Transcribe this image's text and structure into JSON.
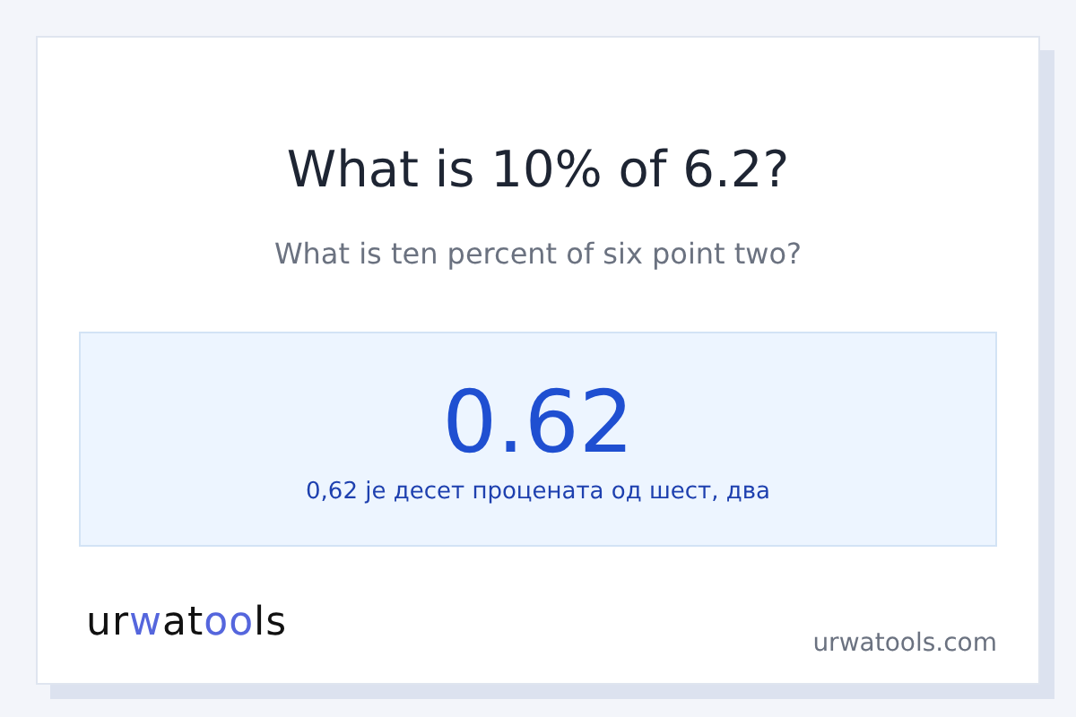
{
  "title": "What is 10% of 6.2?",
  "subtitle": "What is ten percent of six point two?",
  "result": {
    "value": "0.62",
    "sentence": "0,62 је десет процената од шест, два"
  },
  "logo": [
    {
      "text": "ur",
      "accent": false
    },
    {
      "text": "w",
      "accent": true
    },
    {
      "text": "at",
      "accent": false
    },
    {
      "text": "oo",
      "accent": true
    },
    {
      "text": "ls",
      "accent": false
    }
  ],
  "site": "urwatools.com"
}
